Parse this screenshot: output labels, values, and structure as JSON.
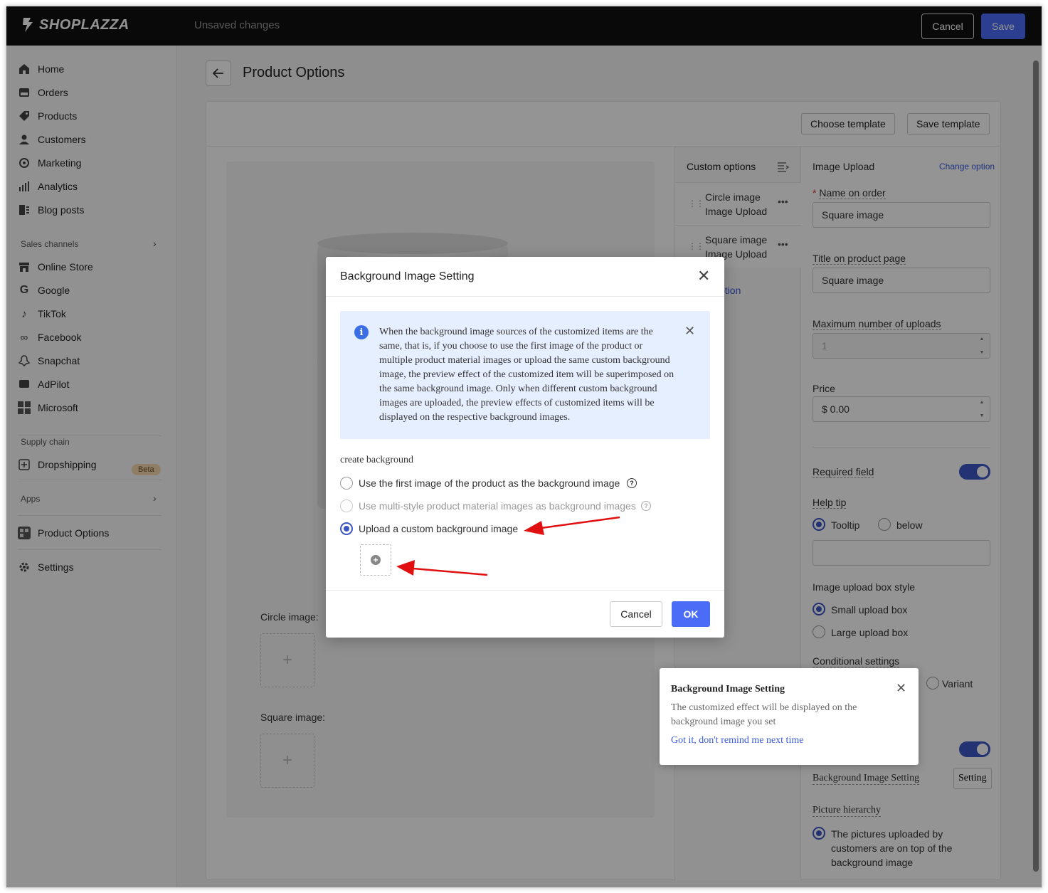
{
  "topbar": {
    "brand": "SHOPLAZZA",
    "status": "Unsaved changes",
    "cancel_label": "Cancel",
    "save_label": "Save"
  },
  "sidebar": {
    "main_items": [
      {
        "label": "Home",
        "icon": "home-icon"
      },
      {
        "label": "Orders",
        "icon": "orders-icon"
      },
      {
        "label": "Products",
        "icon": "tag-icon"
      },
      {
        "label": "Customers",
        "icon": "person-icon"
      },
      {
        "label": "Marketing",
        "icon": "marketing-icon"
      },
      {
        "label": "Analytics",
        "icon": "bar-chart-icon"
      },
      {
        "label": "Blog posts",
        "icon": "blog-icon"
      }
    ],
    "sales_channels_title": "Sales channels",
    "channels": [
      {
        "label": "Online Store",
        "icon": "store-icon"
      },
      {
        "label": "Google",
        "icon": "google-icon"
      },
      {
        "label": "TikTok",
        "icon": "tiktok-icon"
      },
      {
        "label": "Facebook",
        "icon": "meta-icon"
      },
      {
        "label": "Snapchat",
        "icon": "snapchat-icon"
      },
      {
        "label": "AdPilot",
        "icon": "adpilot-icon"
      },
      {
        "label": "Microsoft",
        "icon": "microsoft-icon"
      }
    ],
    "supply_chain_title": "Supply chain",
    "dropshipping_label": "Dropshipping",
    "beta_badge": "Beta",
    "apps_title": "Apps",
    "product_options_label": "Product Options",
    "settings_label": "Settings"
  },
  "page": {
    "title": "Product Options",
    "choose_template": "Choose template",
    "save_template": "Save template",
    "preview": {
      "circle_label": "Circle image:",
      "square_label": "Square image:"
    },
    "custom_options": {
      "title": "Custom options",
      "items": [
        {
          "name": "Circle image",
          "type": "Image Upload"
        },
        {
          "name": "Square image",
          "type": "Image Upload"
        }
      ],
      "add_option_partial": "ption"
    },
    "properties": {
      "section_title": "Image Upload",
      "change_option": "Change option",
      "name_on_order_label": "Name on order",
      "name_on_order_value": "Square image",
      "title_on_page_label": "Title on product page",
      "title_on_page_value": "Square image",
      "max_uploads_label": "Maximum number of uploads",
      "max_uploads_value": "1",
      "price_label": "Price",
      "price_value": "$ 0.00",
      "required_label": "Required field",
      "help_tip_label": "Help tip",
      "help_tip_options": [
        "Tooltip",
        "below"
      ],
      "upload_box_style_label": "Image upload box style",
      "upload_box_options": [
        "Small upload box",
        "Large upload box"
      ],
      "conditional_label": "Conditional settings",
      "variant_label": "Variant",
      "bg_setting_label": "Background Image Setting",
      "setting_button": "Setting",
      "hierarchy_label": "Picture hierarchy",
      "hierarchy_option": "The pictures uploaded by customers are on top of the background image"
    }
  },
  "modal": {
    "title": "Background Image Setting",
    "notice": "When the background image sources of the customized items are the same, that is, if you choose to use the first image of the product or multiple product material images or upload the same custom background image, the preview effect of the customized item will be superimposed on the same background image. Only when different custom background images are uploaded, the preview effects of customized items will be displayed on the respective background images.",
    "section_label": "create background",
    "options": [
      "Use the first image of the product as the background image",
      "Use multi-style product material images as background images",
      "Upload a custom background image"
    ],
    "cancel_label": "Cancel",
    "ok_label": "OK"
  },
  "popover": {
    "title": "Background Image Setting",
    "text": "The customized effect will be displayed on the background image you set",
    "link": "Got it, don't remind me next time"
  },
  "colors": {
    "accent": "#4a6cf7",
    "toggle": "#3b56c4",
    "annotation_arrow": "#e01010"
  }
}
